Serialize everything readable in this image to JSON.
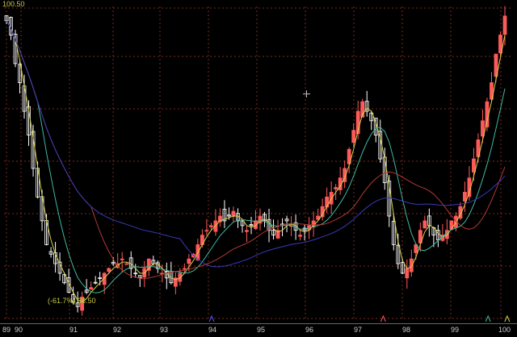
{
  "chart_data": {
    "type": "candlestick",
    "max_label": "100.50",
    "min_label": "(-61.7%) 38.50",
    "x_tick_labels": [
      "89",
      "90",
      "91",
      "92",
      "93",
      "94",
      "95",
      "96",
      "97",
      "98",
      "99",
      "100"
    ],
    "background": "#000000",
    "grid": true,
    "colors": {
      "up": "#ff5a5a",
      "down": "#ffffff",
      "ma_short": "#d4d04a",
      "ma_mid": "#3fb8a0",
      "ma_long": "#b03a30",
      "ma_longest": "#3a3ab8",
      "grid": "#7a2a20",
      "axis_text": "#cccccc",
      "label_text": "#c8c84a"
    },
    "closes": [
      99,
      96,
      90,
      86,
      80,
      75,
      68,
      62,
      57,
      52,
      50,
      48,
      46,
      44,
      42,
      40,
      39,
      41,
      42,
      43,
      44,
      45,
      46,
      47,
      48,
      48,
      49,
      48,
      47,
      46,
      45,
      47,
      49,
      48,
      47,
      46,
      45,
      44,
      45,
      46,
      47,
      49,
      50,
      52,
      54,
      55,
      56,
      57,
      58,
      57,
      58,
      59,
      57,
      56,
      55,
      56,
      57,
      58,
      57,
      55,
      54,
      55,
      56,
      57,
      56,
      55,
      54,
      55,
      56,
      57,
      58,
      60,
      62,
      63,
      64,
      66,
      68,
      72,
      76,
      80,
      82,
      80,
      78,
      75,
      70,
      65,
      58,
      52,
      48,
      46,
      47,
      49,
      52,
      55,
      57,
      56,
      54,
      53,
      54,
      55,
      57,
      58,
      60,
      63,
      66,
      70,
      74,
      78,
      82,
      86,
      92,
      96,
      100
    ],
    "volume_markers": [
      {
        "year_index": 5,
        "color": "#5555ff"
      },
      {
        "year_index": 8.6,
        "color": "#ff5555"
      },
      {
        "year_index": 10.8,
        "color": "#3fb8a0"
      },
      {
        "year_index": 11.2,
        "color": "#d4d04a"
      }
    ]
  }
}
